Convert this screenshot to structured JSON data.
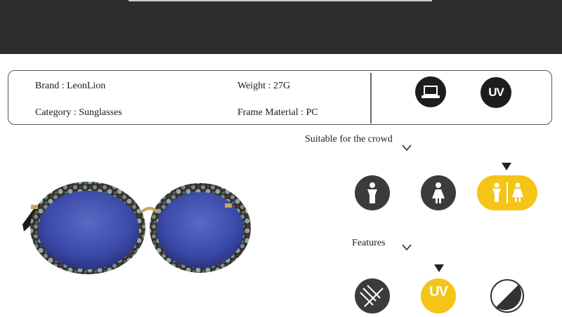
{
  "specs": {
    "brand": "Brand : LeonLion",
    "category": "Category : Sunglasses",
    "weight": "Weight : 27G",
    "frame_material": "Frame Material : PC"
  },
  "spec_icons": [
    "laptop-icon",
    "uv-icon"
  ],
  "uv_label": "UV",
  "crowd": {
    "title": "Suitable for the crowd",
    "options": [
      "male-icon",
      "female-icon",
      "unisex-icon"
    ],
    "selected": "unisex-icon"
  },
  "features": {
    "title": "Features",
    "options": [
      "polarized-icon",
      "uv-icon",
      "half-tone-icon"
    ],
    "selected": "uv-icon",
    "uv_label": "UV"
  },
  "colors": {
    "band": "#2e2d2d",
    "accent_yellow": "#f4c516",
    "icon_dark": "#3b3b3b",
    "lens_blue": "#3b4aa8"
  }
}
